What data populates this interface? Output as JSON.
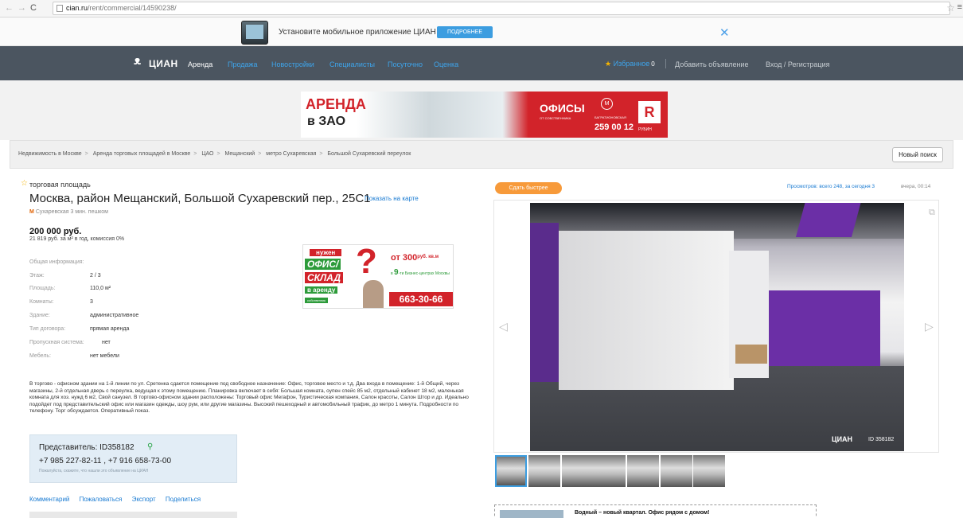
{
  "browser": {
    "url_host": "cian.ru",
    "url_path": "/rent/commercial/14590238/"
  },
  "app_banner": {
    "text": "Установите мобильное приложение ЦИАН",
    "more_label": "ПОДРОБНЕЕ",
    "close_label": "✕"
  },
  "nav": {
    "logo": "ЦИАН",
    "items": [
      "Аренда",
      "Продажа",
      "Новостройки",
      "Специалисты",
      "Посуточно",
      "Оценка"
    ],
    "favorites_label": "Избранное",
    "favorites_count": "0",
    "add_listing": "Добавить объявление",
    "login": "Вход / Регистрация"
  },
  "top_ad": {
    "line1": "АРЕНДА",
    "line2": "в ЗАО",
    "offices": "ОФИСЫ",
    "owner": "ОТ СОБСТВЕННИКА",
    "station": "БАГРАТИОНОВСКАЯ",
    "phone": "259 00 12",
    "brand_letter": "R",
    "brand": "РУБИН"
  },
  "breadcrumbs": [
    "Недвижимость в Москве",
    "Аренда торговых площадей в Москве",
    "ЦАО",
    "Мещанский",
    "метро Сухаревская",
    "Большой Сухаревский переулок"
  ],
  "new_search_label": "Новый поиск",
  "listing": {
    "type": "торговая площадь",
    "address": "Москва, район Мещанский, Большой Сухаревский пер., 25С1",
    "show_on_map": "Показать на карте",
    "metro": "Сухаревская 3 мин. пешком",
    "price": "200 000 руб.",
    "price_details": "21 819 руб. за м² в год, комиссия 0%",
    "info_title": "Общая информация:",
    "info": [
      {
        "label": "Этаж:",
        "value": "2 / 3"
      },
      {
        "label": "Площадь:",
        "value": "110,0 м²"
      },
      {
        "label": "Комнаты:",
        "value": "3"
      },
      {
        "label": "Здание:",
        "value": "административное"
      },
      {
        "label": "Тип договора:",
        "value": "прямая аренда"
      },
      {
        "label": "Пропускная система:",
        "value": "нет"
      },
      {
        "label": "Мебель:",
        "value": "нет мебели"
      }
    ],
    "description": "В торгово - офисном здании на 1-й линии по ул. Сретенка сдается помещение под свободное назначение: Офис, торговое место и т.д. Два входа в помещение: 1-й Общий, через магазины, 2-й отдельная дверь с переулка, ведущая к этому помещению. Планировка включает в себя: Большая комната, оупен спейс 85 м2, отдельный кабинет 18 м2, маленькая комната для хоз. нужд 6 м2, Свой санузел. В торгово-офисном здании расположены: Торговый офис Мегафон, Туристическая компания, Салон красоты, Салон Штор и др. Идеально подойдет под представительский офис или магазин одежды, шоу рум, или другие магазины. Высокий пешеходный и автомобильный трафик, до метро 1 минута. Подробности по телефону. Торг обсуждается. Оперативный показ."
  },
  "mid_ad": {
    "need": "нужен",
    "office": "ОФИС/",
    "warehouse": "СКЛАД",
    "rent": "в аренду",
    "owner": "собственник",
    "from": "от 300",
    "from_unit": "руб. кв.м",
    "bc_prefix": "в",
    "bc_num": "9",
    "bc_text": "-ти Бизнес-центрах Москвы",
    "phone": "663-30-66"
  },
  "agent": {
    "name": "Представитель: ID358182",
    "phones": "+7 985 227-82-11 , +7 916 658-73-00",
    "note": "Пожалуйста, скажите, что нашли это объявление на ЦИАН"
  },
  "actions": [
    "Комментарий",
    "Пожаловаться",
    "Экспорт",
    "Поделиться"
  ],
  "right": {
    "sell_fast": "Сдать быстрее",
    "views": "Просмотров: всего 248, за сегодня 3",
    "posted": "вчера, 00:14",
    "watermark_logo": "ЦИАН",
    "watermark_id": "ID 358182",
    "thumbnail_count": 7,
    "promo_text": "Водный – новый квартал. Офис рядом с домом!"
  },
  "colors": {
    "nav_bg": "#4b5560",
    "link": "#1a7bd2",
    "accent_orange": "#f79a3a",
    "agent_bg": "#e2edf6"
  }
}
